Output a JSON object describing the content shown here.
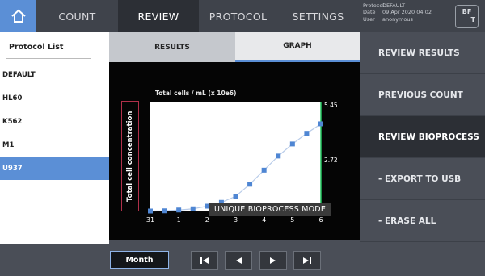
{
  "nav": {
    "items": [
      "COUNT",
      "REVIEW",
      "PROTOCOL",
      "SETTINGS"
    ],
    "active": "REVIEW"
  },
  "status": {
    "protocol_label": "Protocol",
    "protocol_value": "DEFAULT",
    "date_label": "Date",
    "date_value": "09 Apr 2020 04:02",
    "user_label": "User",
    "user_value": "anonymous",
    "logo_line1": "BF",
    "logo_line2": "T"
  },
  "protocol_list": {
    "title": "Protocol List",
    "items": [
      "DEFAULT",
      "HL60",
      "K562",
      "M1",
      "U937"
    ],
    "selected": "U937"
  },
  "tabs": {
    "results": "RESULTS",
    "graph": "GRAPH",
    "active": "GRAPH"
  },
  "chart_data": {
    "type": "line",
    "title": "Total cells / mL (x 10e6)",
    "ylabel": "Total cell concentration",
    "x_tick_labels": [
      "31",
      "1",
      "2",
      "3",
      "4",
      "5",
      "6"
    ],
    "x": [
      0,
      0.5,
      1,
      1.5,
      2,
      2.5,
      3,
      3.5,
      4,
      4.5,
      5,
      5.5,
      6
    ],
    "values": [
      0.02,
      0.03,
      0.07,
      0.13,
      0.26,
      0.45,
      0.75,
      1.35,
      2.05,
      2.75,
      3.35,
      3.88,
      4.35
    ],
    "ylim": [
      0,
      5.45
    ],
    "y_marker_labels": [
      "5.45",
      "2.72"
    ],
    "marker_line_x": 6,
    "grid": false,
    "line_color": "#b9cce9",
    "marker_color": "#4f86d3",
    "marker_line_color": "#22c55e"
  },
  "overlay_caption": "UNIQUE BIOPROCESS MODE",
  "right_panel": {
    "items": [
      "REVIEW RESULTS",
      "PREVIOUS COUNT",
      "REVIEW BIOPROCESS",
      "- EXPORT TO USB",
      "- ERASE ALL"
    ],
    "active": "REVIEW BIOPROCESS"
  },
  "footer": {
    "month_label": "Month",
    "nav_icons": [
      "first-page-icon",
      "previous-icon",
      "next-icon",
      "last-page-icon"
    ]
  },
  "colors": {
    "accent": "#5b8fd6",
    "topbar": "#3f434b",
    "panel": "#4a4e57",
    "active": "#2c2f35"
  }
}
